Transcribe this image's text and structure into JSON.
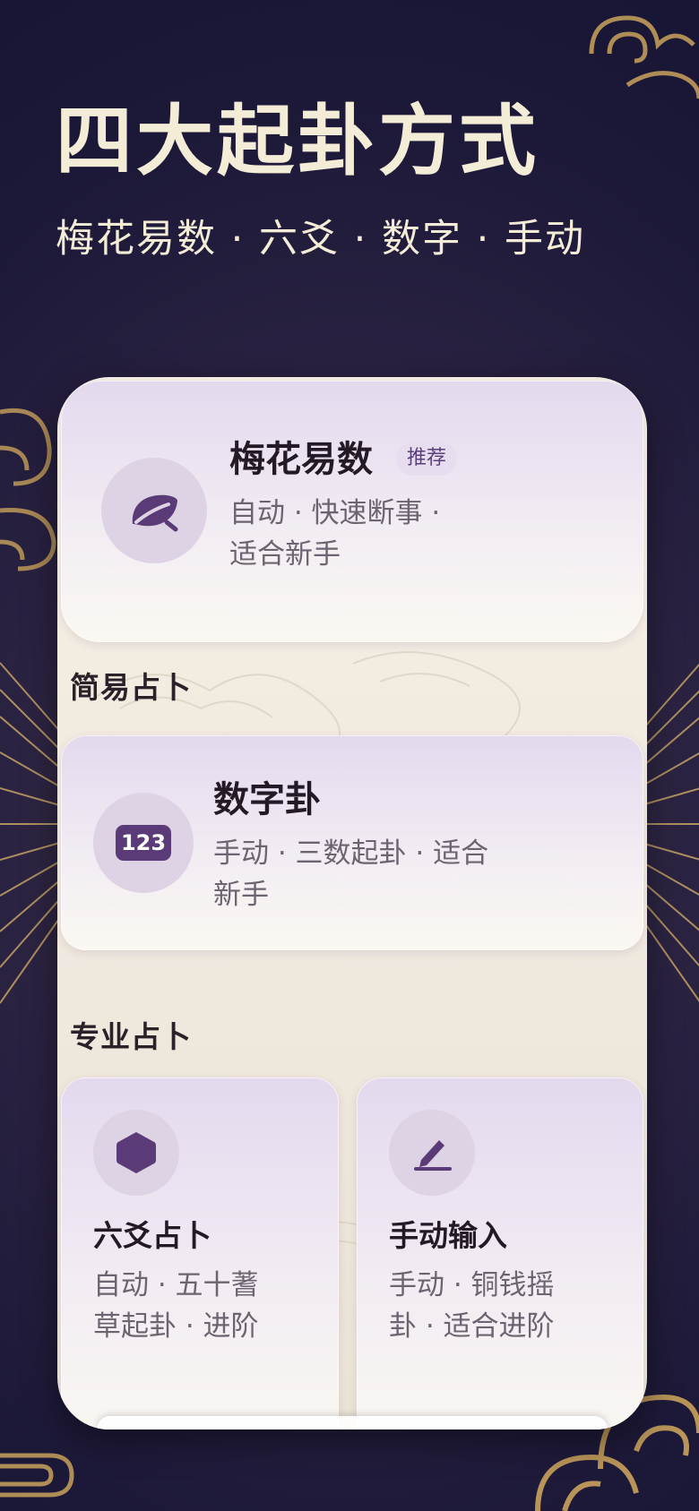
{
  "hero": {
    "title": "四大起卦方式",
    "subtitle": "梅花易数 · 六爻 · 数字 · 手动"
  },
  "featured": {
    "title": "梅花易数",
    "badge": "推荐",
    "desc_line1": "自动 · 快速断事 ·",
    "desc_line2": "适合新手",
    "icon": "leaf-icon"
  },
  "simple_section": {
    "label": "简易占卜",
    "card": {
      "title": "数字卦",
      "desc_line1": "手动 · 三数起卦 · 适合",
      "desc_line2": "新手",
      "icon": "numbers-123-icon",
      "icon_text": "123"
    }
  },
  "pro_section": {
    "label": "专业占卜",
    "cards": [
      {
        "title": "六爻占卜",
        "desc_line1": "自动 · 五十蓍",
        "desc_line2": "草起卦 · 进阶",
        "icon": "hexagon-icon"
      },
      {
        "title": "手动输入",
        "desc_line1": "手动 · 铜钱摇",
        "desc_line2": "卦 · 适合进阶",
        "icon": "pencil-icon"
      }
    ]
  },
  "colors": {
    "accent": "#5b3a78",
    "gold": "#c9a25c",
    "hero_text": "#f3ecd6"
  }
}
